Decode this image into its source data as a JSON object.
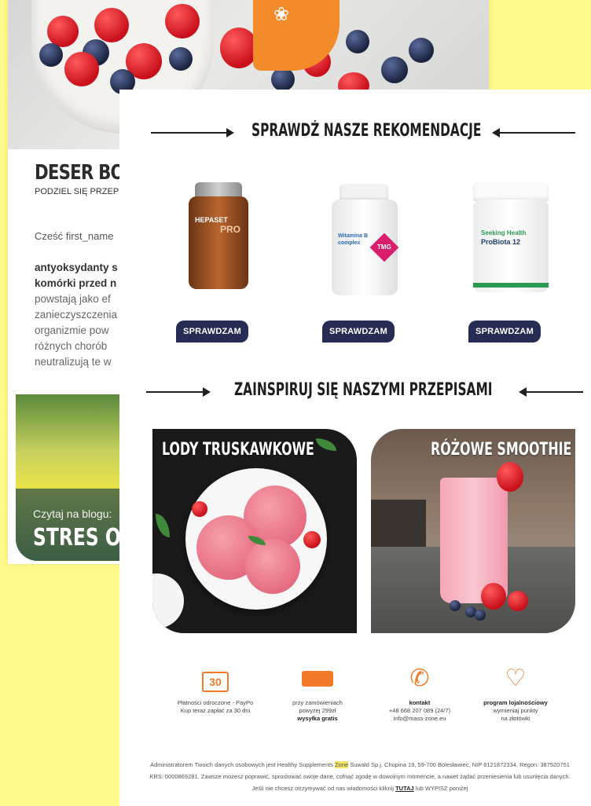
{
  "back_email": {
    "title": "DESER BOGA",
    "subtitle": "PODZIEL SIĘ PRZEPI",
    "greeting": "Cześć first_name",
    "bold_lines": [
      "antyoksydanty s",
      "komórki przed n"
    ],
    "body_lines": [
      "powstają jako ef",
      "zanieczyszczenia",
      "organizmie pow",
      "różnych chorób",
      "neutralizują te w"
    ],
    "blog_small": "Czytaj na blogu:",
    "blog_big": "STRES OKS"
  },
  "front_email": {
    "recommend_heading": "SPRAWDŹ NASZE REKOMENDACJE",
    "inspire_heading": "ZAINSPIRUJ SIĘ NASZYMI PRZEPISAMI",
    "products": [
      {
        "label1": "HEPASET",
        "label2": "PRO",
        "button": "SPRAWDZAM"
      },
      {
        "label1": "Witamina B complex",
        "label2": "TMG",
        "button": "SPRAWDZAM"
      },
      {
        "label1": "Seeking Health",
        "label2": "ProBiota 12",
        "button": "SPRAWDZAM"
      }
    ],
    "recipes": [
      {
        "title": "LODY TRUSKAWKOWE"
      },
      {
        "title": "RÓŻOWE SMOOTHIE"
      }
    ],
    "features": [
      {
        "icon": "calendar-30-icon",
        "glyph": "30",
        "line1": "Płatności odroczone - PayPo",
        "line2": "Kup teraz zapłać za 30 dni"
      },
      {
        "icon": "delivery-truck-icon",
        "glyph": "🚚",
        "line1": "przy zamówieniach",
        "line2": "powyżej 299zł",
        "line3": "wysyłka gratis"
      },
      {
        "icon": "phone-icon",
        "glyph": "✆",
        "line1": "kontakt",
        "line2": "+48 668 207 089 (24/7)",
        "line3": "info@mass-zone.eu"
      },
      {
        "icon": "heart-icon",
        "glyph": "♡",
        "line1": "program lojalnościowy",
        "line2": "wymieniaj punkty",
        "line3": "na złotówki"
      }
    ],
    "footer": {
      "part1": "Administratorem Twoich danych osobowych jest Healthy Supplements ",
      "highlight": "Zone",
      "part2": " Suwald Sp.j. Chopina 19, 59-700 Bolesławiec, NIP 6121872334, Regon: 387520751 KRS: 0000869281. Zawsze możesz poprawić, sprostować swoje dane, cofnąć zgodę w dowolnym momencie, a nawet żądać przeniesienia lub usunięcia danych. Jeśli nie chcesz otrzymywać od nas wiadomości kliknij ",
      "link": "TUTAJ",
      "part3": " lub WYPISZ poniżej"
    }
  },
  "colors": {
    "background": "#fdf98a",
    "button": "#262c54",
    "accent_orange": "#f07a28"
  }
}
